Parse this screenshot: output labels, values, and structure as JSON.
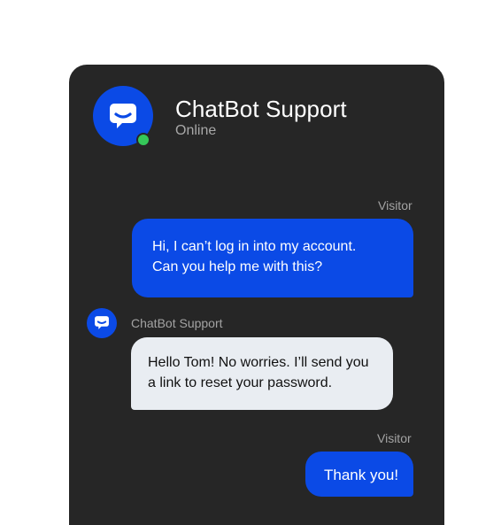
{
  "header": {
    "title": "ChatBot Support",
    "status": "Online",
    "avatar_icon": "chat-bubble-icon",
    "status_color": "#35c759"
  },
  "colors": {
    "window_bg": "#262626",
    "accent": "#0b4ae6",
    "bot_bubble": "#e9edf2"
  },
  "messages": [
    {
      "sender": "Visitor",
      "lines": [
        "Hi, I can’t log in into my account.",
        "Can you help me with this?"
      ]
    },
    {
      "sender": "ChatBot Support",
      "lines": [
        "Hello Tom! No worries. I’ll send you",
        "a link to reset your password."
      ]
    },
    {
      "sender": "Visitor",
      "lines": [
        "Thank you!"
      ]
    }
  ]
}
